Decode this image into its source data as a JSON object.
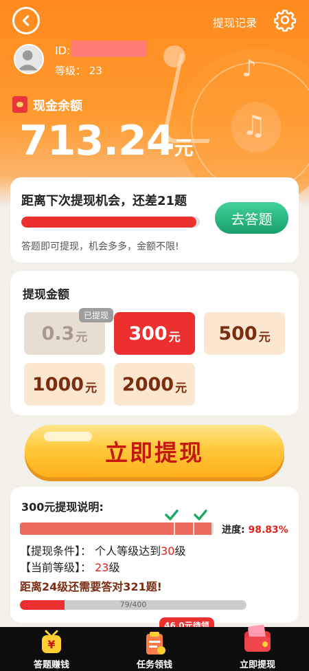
{
  "header": {
    "record_link": "提现记录",
    "user_id_label": "ID:",
    "level_label": "等级：",
    "level_value": "23"
  },
  "balance": {
    "label": "现金余额",
    "amount": "713.24",
    "unit": "元"
  },
  "next_chance": {
    "title": "距离下次提现机会，还差21题",
    "progress_fraction": 0.98,
    "button": "去答题",
    "note": "答题即可提现，机会多多，金额不限!"
  },
  "amounts": {
    "title": "提现金额",
    "used_badge": "已提现",
    "options": [
      {
        "value": "0.3",
        "unit": "元",
        "state": "used"
      },
      {
        "value": "300",
        "unit": "元",
        "state": "selected"
      },
      {
        "value": "500",
        "unit": "元",
        "state": "normal"
      },
      {
        "value": "1000",
        "unit": "元",
        "state": "normal"
      },
      {
        "value": "2000",
        "unit": "元",
        "state": "normal"
      }
    ]
  },
  "withdraw_button": "立即提现",
  "description": {
    "title": "300元提现说明:",
    "progress_label": "进度:",
    "progress_pct": "98.83%",
    "progress_fraction": 0.9883,
    "cond1_label": "【提现条件】：",
    "cond1_text": "个人等级达到",
    "cond1_value": "30",
    "cond1_unit": "级",
    "cond2_label": "【当前等级】：",
    "cond2_value": "23",
    "cond2_unit": "级",
    "remaining": "距离24级还需要答对321题!",
    "question_progress_text": "79/400",
    "question_progress_fraction": 0.1975
  },
  "tabbar": {
    "tabs": [
      {
        "label": "答题赚钱",
        "icon": "money-bag-icon"
      },
      {
        "label": "任务领钱",
        "icon": "task-clipboard-icon"
      },
      {
        "label": "立即提现",
        "icon": "wallet-icon"
      }
    ],
    "badge": "46.0元待领"
  },
  "colors": {
    "brand_orange": "#ff8a1e",
    "accent_red": "#ec2f2f",
    "go_green": "#18a06c",
    "gold": "#ffc93c"
  }
}
